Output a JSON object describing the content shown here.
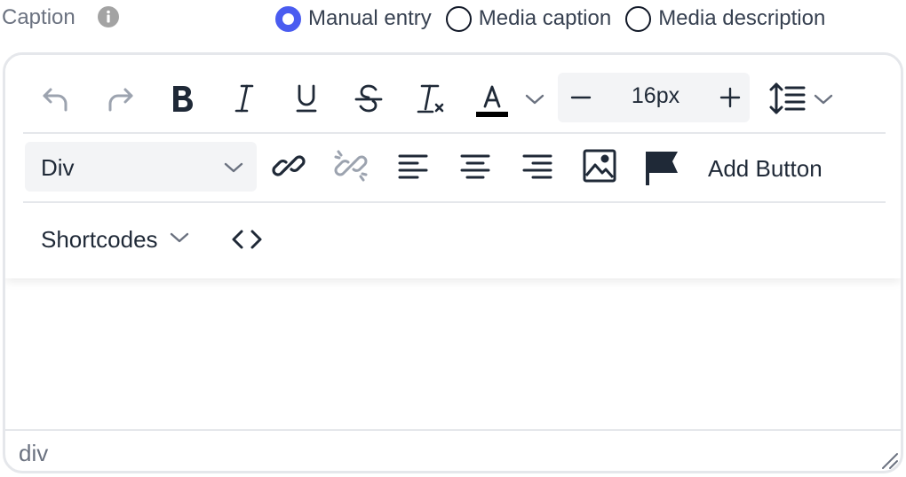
{
  "field": {
    "label": "Caption",
    "info_icon": "info-circle-icon"
  },
  "caption_source": {
    "options": [
      {
        "label": "Manual entry",
        "checked": true
      },
      {
        "label": "Media caption",
        "checked": false
      },
      {
        "label": "Media description",
        "checked": false
      }
    ],
    "accent_color": "#4a5cf0"
  },
  "toolbar": {
    "row1_icons": [
      "undo-icon",
      "redo-icon",
      "bold-icon",
      "italic-icon",
      "underline-icon",
      "strikethrough-icon",
      "clear-formatting-icon",
      "text-color-icon",
      "chevron-down-icon"
    ],
    "font_size": "16px",
    "text_color": "#000000",
    "row2_icons": [
      "link-icon",
      "unlink-icon",
      "align-left-icon",
      "align-center-icon",
      "align-right-icon",
      "image-icon",
      "flag-icon"
    ],
    "block_format": "Div",
    "add_button_label": "Add Button",
    "shortcodes_label": "Shortcodes",
    "source_code_icon": "code-icon"
  },
  "statusbar": {
    "path": "div"
  }
}
